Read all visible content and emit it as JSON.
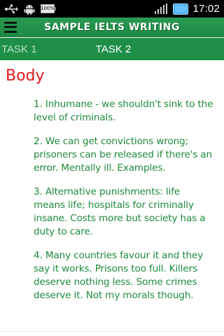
{
  "status_bar": {
    "battery_label": "100%",
    "time": "17:02",
    "icons": [
      "usb-icon",
      "android-icon",
      "battery-icon",
      "signal-icon",
      "sd-card-icon"
    ]
  },
  "app_bar": {
    "title": "SAMPLE IELTS WRITING",
    "menu_icon": "hamburger-menu-icon"
  },
  "tabs": [
    {
      "label": "TASK 1",
      "active": false
    },
    {
      "label": "TASK 2",
      "active": true
    }
  ],
  "content": {
    "section_title": "Body",
    "points": [
      "1. Inhumane - we shouldn't sink to the level of criminals.",
      "2. We can get convictions wrong; prisoners can be released if there's an error. Mentally ill. Examples.",
      "3. Alternative punishments: life means life; hospitals for criminally insane. Costs more but society has a duty to care.",
      "4. Many countries favour it and they say it works. Prisons too full. Killers deserve nothing less. Some crimes deserve it. Not my morals though."
    ]
  },
  "colors": {
    "app_bar_green": "#1f8a45",
    "title_red": "#e01a1a",
    "text_green": "#1e8a3c"
  }
}
